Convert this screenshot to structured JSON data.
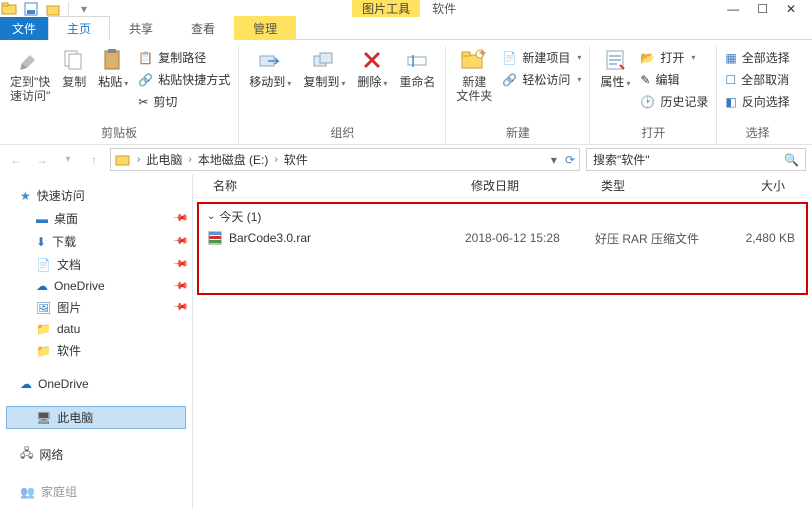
{
  "title_context_tab": "图片工具",
  "title_context_name": "软件",
  "tabs": {
    "file": "文件",
    "home": "主页",
    "share": "共享",
    "view": "查看",
    "manage": "管理"
  },
  "ribbon": {
    "clipboard": {
      "pin": "定到\"快\n速访问\"",
      "copy": "复制",
      "paste": "粘贴",
      "copy_path": "复制路径",
      "paste_shortcut": "粘贴快捷方式",
      "cut": "剪切",
      "group": "剪贴板"
    },
    "organize": {
      "move_to": "移动到",
      "copy_to": "复制到",
      "delete": "删除",
      "rename": "重命名",
      "group": "组织"
    },
    "new": {
      "new_folder": "新建\n文件夹",
      "new_item": "新建项目",
      "easy_access": "轻松访问",
      "group": "新建"
    },
    "open": {
      "properties": "属性",
      "open": "打开",
      "edit": "编辑",
      "history": "历史记录",
      "group": "打开"
    },
    "select": {
      "select_all": "全部选择",
      "select_none": "全部取消",
      "invert": "反向选择",
      "group": "选择"
    }
  },
  "breadcrumb": {
    "pc": "此电脑",
    "drive": "本地磁盘 (E:)",
    "folder": "软件"
  },
  "search_placeholder": "搜索\"软件\"",
  "columns": {
    "name": "名称",
    "date": "修改日期",
    "type": "类型",
    "size": "大小"
  },
  "group_header": "今天 (1)",
  "file": {
    "name": "BarCode3.0.rar",
    "date": "2018-06-12 15:28",
    "type": "好压 RAR 压缩文件",
    "size": "2,480 KB"
  },
  "nav": {
    "quick_access": "快速访问",
    "desktop": "桌面",
    "downloads": "下载",
    "documents": "文档",
    "onedrive_q": "OneDrive",
    "pictures": "图片",
    "datu": "datu",
    "software": "软件",
    "onedrive": "OneDrive",
    "this_pc": "此电脑",
    "network": "网络",
    "homegroup": "家庭组"
  }
}
